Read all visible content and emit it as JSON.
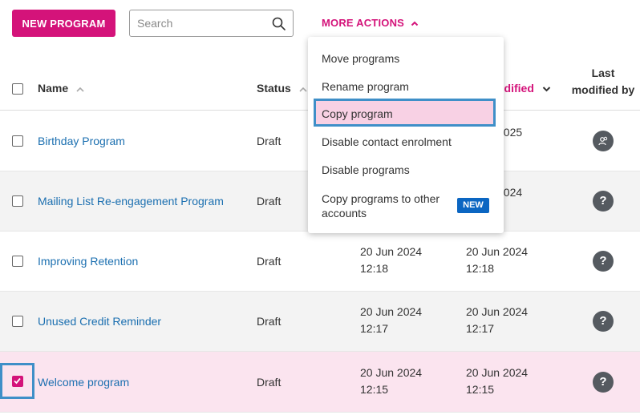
{
  "toolbar": {
    "new_program_label": "NEW PROGRAM",
    "search_placeholder": "Search",
    "more_actions_label": "MORE ACTIONS"
  },
  "colors": {
    "accent": "#d4137a",
    "link": "#1b6fb0",
    "highlight_border": "#3f8fc8",
    "selected_row": "#fbe4ef",
    "new_badge": "#0b66c2"
  },
  "table": {
    "headers": {
      "name": "Name",
      "status": "Status",
      "modified": "odified",
      "last_modified_by_line1": "Last",
      "last_modified_by_line2": "modified by"
    },
    "rows": [
      {
        "name": "Birthday Program",
        "status": "Draft",
        "created_date": "",
        "created_time": "",
        "modified_date": "2025",
        "modified_time": "",
        "avatar": "user-group-icon",
        "checked": false
      },
      {
        "name": "Mailing List Re-engagement Program",
        "status": "Draft",
        "created_date": "",
        "created_time": "",
        "modified_date": "2024",
        "modified_time": "",
        "avatar": "?",
        "checked": false
      },
      {
        "name": "Improving Retention",
        "status": "Draft",
        "created_date": "20 Jun 2024",
        "created_time": "12:18",
        "modified_date": "20 Jun 2024",
        "modified_time": "12:18",
        "avatar": "?",
        "checked": false
      },
      {
        "name": "Unused Credit Reminder",
        "status": "Draft",
        "created_date": "20 Jun 2024",
        "created_time": "12:17",
        "modified_date": "20 Jun 2024",
        "modified_time": "12:17",
        "avatar": "?",
        "checked": false
      },
      {
        "name": "Welcome program",
        "status": "Draft",
        "created_date": "20 Jun 2024",
        "created_time": "12:15",
        "modified_date": "20 Jun 2024",
        "modified_time": "12:15",
        "avatar": "?",
        "checked": true
      }
    ]
  },
  "dropdown": {
    "items": [
      "Move programs",
      "Rename program",
      "Copy program",
      "Disable contact enrolment",
      "Disable programs",
      "Copy programs to other"
    ],
    "last_item_line2": "accounts",
    "new_badge": "NEW"
  }
}
